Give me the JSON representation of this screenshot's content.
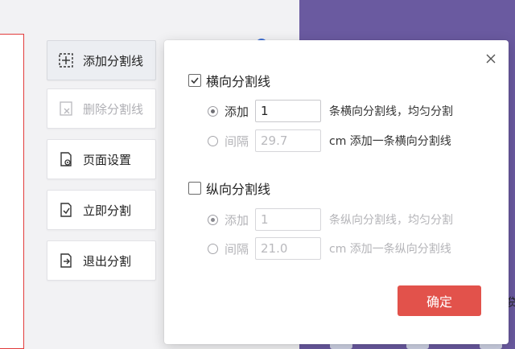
{
  "toolbar": {
    "add_split": "添加分割线",
    "delete_split": "删除分割线",
    "page_setup": "页面设置",
    "split_now": "立即分割",
    "exit_split": "退出分割"
  },
  "dialog": {
    "horizontal": {
      "title": "横向分割线",
      "checked": true,
      "add_label": "添加",
      "add_value": "1",
      "add_suffix": "条横向分割线，均匀分割",
      "interval_label": "间隔",
      "interval_value": "29.7",
      "interval_suffix": "cm 添加一条横向分割线"
    },
    "vertical": {
      "title": "纵向分割线",
      "checked": false,
      "add_label": "添加",
      "add_value": "1",
      "add_suffix": "条纵向分割线，均匀分割",
      "interval_label": "间隔",
      "interval_value": "21.0",
      "interval_suffix": "cm 添加一条纵向分割线"
    },
    "confirm_label": "确定"
  },
  "background": {
    "right_edge_text": "贷"
  },
  "colors": {
    "accent": "#e2524b",
    "side_panel": "#6a5aa0",
    "page_border": "#e23c3c"
  }
}
